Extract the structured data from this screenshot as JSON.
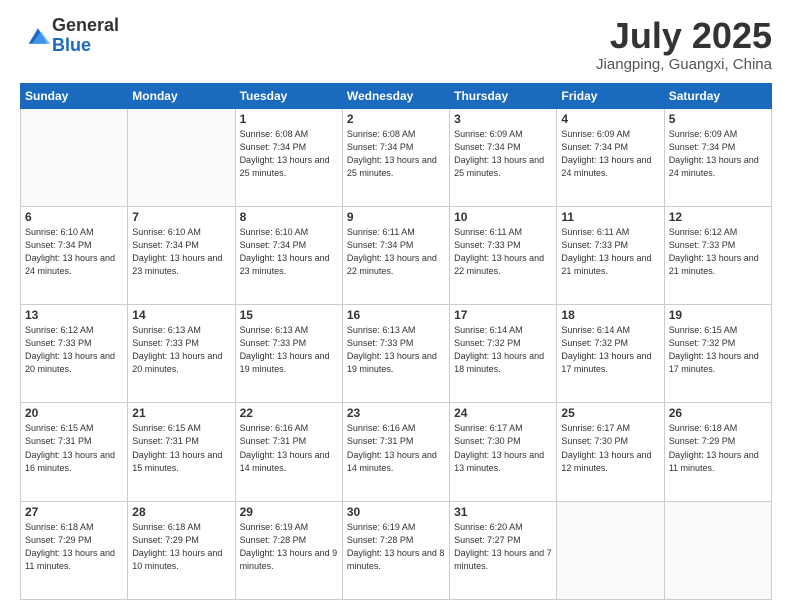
{
  "header": {
    "logo_line1": "General",
    "logo_line2": "Blue",
    "month": "July 2025",
    "location": "Jiangping, Guangxi, China"
  },
  "weekdays": [
    "Sunday",
    "Monday",
    "Tuesday",
    "Wednesday",
    "Thursday",
    "Friday",
    "Saturday"
  ],
  "weeks": [
    [
      {
        "day": "",
        "sunrise": "",
        "sunset": "",
        "daylight": ""
      },
      {
        "day": "",
        "sunrise": "",
        "sunset": "",
        "daylight": ""
      },
      {
        "day": "1",
        "sunrise": "Sunrise: 6:08 AM",
        "sunset": "Sunset: 7:34 PM",
        "daylight": "Daylight: 13 hours and 25 minutes."
      },
      {
        "day": "2",
        "sunrise": "Sunrise: 6:08 AM",
        "sunset": "Sunset: 7:34 PM",
        "daylight": "Daylight: 13 hours and 25 minutes."
      },
      {
        "day": "3",
        "sunrise": "Sunrise: 6:09 AM",
        "sunset": "Sunset: 7:34 PM",
        "daylight": "Daylight: 13 hours and 25 minutes."
      },
      {
        "day": "4",
        "sunrise": "Sunrise: 6:09 AM",
        "sunset": "Sunset: 7:34 PM",
        "daylight": "Daylight: 13 hours and 24 minutes."
      },
      {
        "day": "5",
        "sunrise": "Sunrise: 6:09 AM",
        "sunset": "Sunset: 7:34 PM",
        "daylight": "Daylight: 13 hours and 24 minutes."
      }
    ],
    [
      {
        "day": "6",
        "sunrise": "Sunrise: 6:10 AM",
        "sunset": "Sunset: 7:34 PM",
        "daylight": "Daylight: 13 hours and 24 minutes."
      },
      {
        "day": "7",
        "sunrise": "Sunrise: 6:10 AM",
        "sunset": "Sunset: 7:34 PM",
        "daylight": "Daylight: 13 hours and 23 minutes."
      },
      {
        "day": "8",
        "sunrise": "Sunrise: 6:10 AM",
        "sunset": "Sunset: 7:34 PM",
        "daylight": "Daylight: 13 hours and 23 minutes."
      },
      {
        "day": "9",
        "sunrise": "Sunrise: 6:11 AM",
        "sunset": "Sunset: 7:34 PM",
        "daylight": "Daylight: 13 hours and 22 minutes."
      },
      {
        "day": "10",
        "sunrise": "Sunrise: 6:11 AM",
        "sunset": "Sunset: 7:33 PM",
        "daylight": "Daylight: 13 hours and 22 minutes."
      },
      {
        "day": "11",
        "sunrise": "Sunrise: 6:11 AM",
        "sunset": "Sunset: 7:33 PM",
        "daylight": "Daylight: 13 hours and 21 minutes."
      },
      {
        "day": "12",
        "sunrise": "Sunrise: 6:12 AM",
        "sunset": "Sunset: 7:33 PM",
        "daylight": "Daylight: 13 hours and 21 minutes."
      }
    ],
    [
      {
        "day": "13",
        "sunrise": "Sunrise: 6:12 AM",
        "sunset": "Sunset: 7:33 PM",
        "daylight": "Daylight: 13 hours and 20 minutes."
      },
      {
        "day": "14",
        "sunrise": "Sunrise: 6:13 AM",
        "sunset": "Sunset: 7:33 PM",
        "daylight": "Daylight: 13 hours and 20 minutes."
      },
      {
        "day": "15",
        "sunrise": "Sunrise: 6:13 AM",
        "sunset": "Sunset: 7:33 PM",
        "daylight": "Daylight: 13 hours and 19 minutes."
      },
      {
        "day": "16",
        "sunrise": "Sunrise: 6:13 AM",
        "sunset": "Sunset: 7:33 PM",
        "daylight": "Daylight: 13 hours and 19 minutes."
      },
      {
        "day": "17",
        "sunrise": "Sunrise: 6:14 AM",
        "sunset": "Sunset: 7:32 PM",
        "daylight": "Daylight: 13 hours and 18 minutes."
      },
      {
        "day": "18",
        "sunrise": "Sunrise: 6:14 AM",
        "sunset": "Sunset: 7:32 PM",
        "daylight": "Daylight: 13 hours and 17 minutes."
      },
      {
        "day": "19",
        "sunrise": "Sunrise: 6:15 AM",
        "sunset": "Sunset: 7:32 PM",
        "daylight": "Daylight: 13 hours and 17 minutes."
      }
    ],
    [
      {
        "day": "20",
        "sunrise": "Sunrise: 6:15 AM",
        "sunset": "Sunset: 7:31 PM",
        "daylight": "Daylight: 13 hours and 16 minutes."
      },
      {
        "day": "21",
        "sunrise": "Sunrise: 6:15 AM",
        "sunset": "Sunset: 7:31 PM",
        "daylight": "Daylight: 13 hours and 15 minutes."
      },
      {
        "day": "22",
        "sunrise": "Sunrise: 6:16 AM",
        "sunset": "Sunset: 7:31 PM",
        "daylight": "Daylight: 13 hours and 14 minutes."
      },
      {
        "day": "23",
        "sunrise": "Sunrise: 6:16 AM",
        "sunset": "Sunset: 7:31 PM",
        "daylight": "Daylight: 13 hours and 14 minutes."
      },
      {
        "day": "24",
        "sunrise": "Sunrise: 6:17 AM",
        "sunset": "Sunset: 7:30 PM",
        "daylight": "Daylight: 13 hours and 13 minutes."
      },
      {
        "day": "25",
        "sunrise": "Sunrise: 6:17 AM",
        "sunset": "Sunset: 7:30 PM",
        "daylight": "Daylight: 13 hours and 12 minutes."
      },
      {
        "day": "26",
        "sunrise": "Sunrise: 6:18 AM",
        "sunset": "Sunset: 7:29 PM",
        "daylight": "Daylight: 13 hours and 11 minutes."
      }
    ],
    [
      {
        "day": "27",
        "sunrise": "Sunrise: 6:18 AM",
        "sunset": "Sunset: 7:29 PM",
        "daylight": "Daylight: 13 hours and 11 minutes."
      },
      {
        "day": "28",
        "sunrise": "Sunrise: 6:18 AM",
        "sunset": "Sunset: 7:29 PM",
        "daylight": "Daylight: 13 hours and 10 minutes."
      },
      {
        "day": "29",
        "sunrise": "Sunrise: 6:19 AM",
        "sunset": "Sunset: 7:28 PM",
        "daylight": "Daylight: 13 hours and 9 minutes."
      },
      {
        "day": "30",
        "sunrise": "Sunrise: 6:19 AM",
        "sunset": "Sunset: 7:28 PM",
        "daylight": "Daylight: 13 hours and 8 minutes."
      },
      {
        "day": "31",
        "sunrise": "Sunrise: 6:20 AM",
        "sunset": "Sunset: 7:27 PM",
        "daylight": "Daylight: 13 hours and 7 minutes."
      },
      {
        "day": "",
        "sunrise": "",
        "sunset": "",
        "daylight": ""
      },
      {
        "day": "",
        "sunrise": "",
        "sunset": "",
        "daylight": ""
      }
    ]
  ]
}
